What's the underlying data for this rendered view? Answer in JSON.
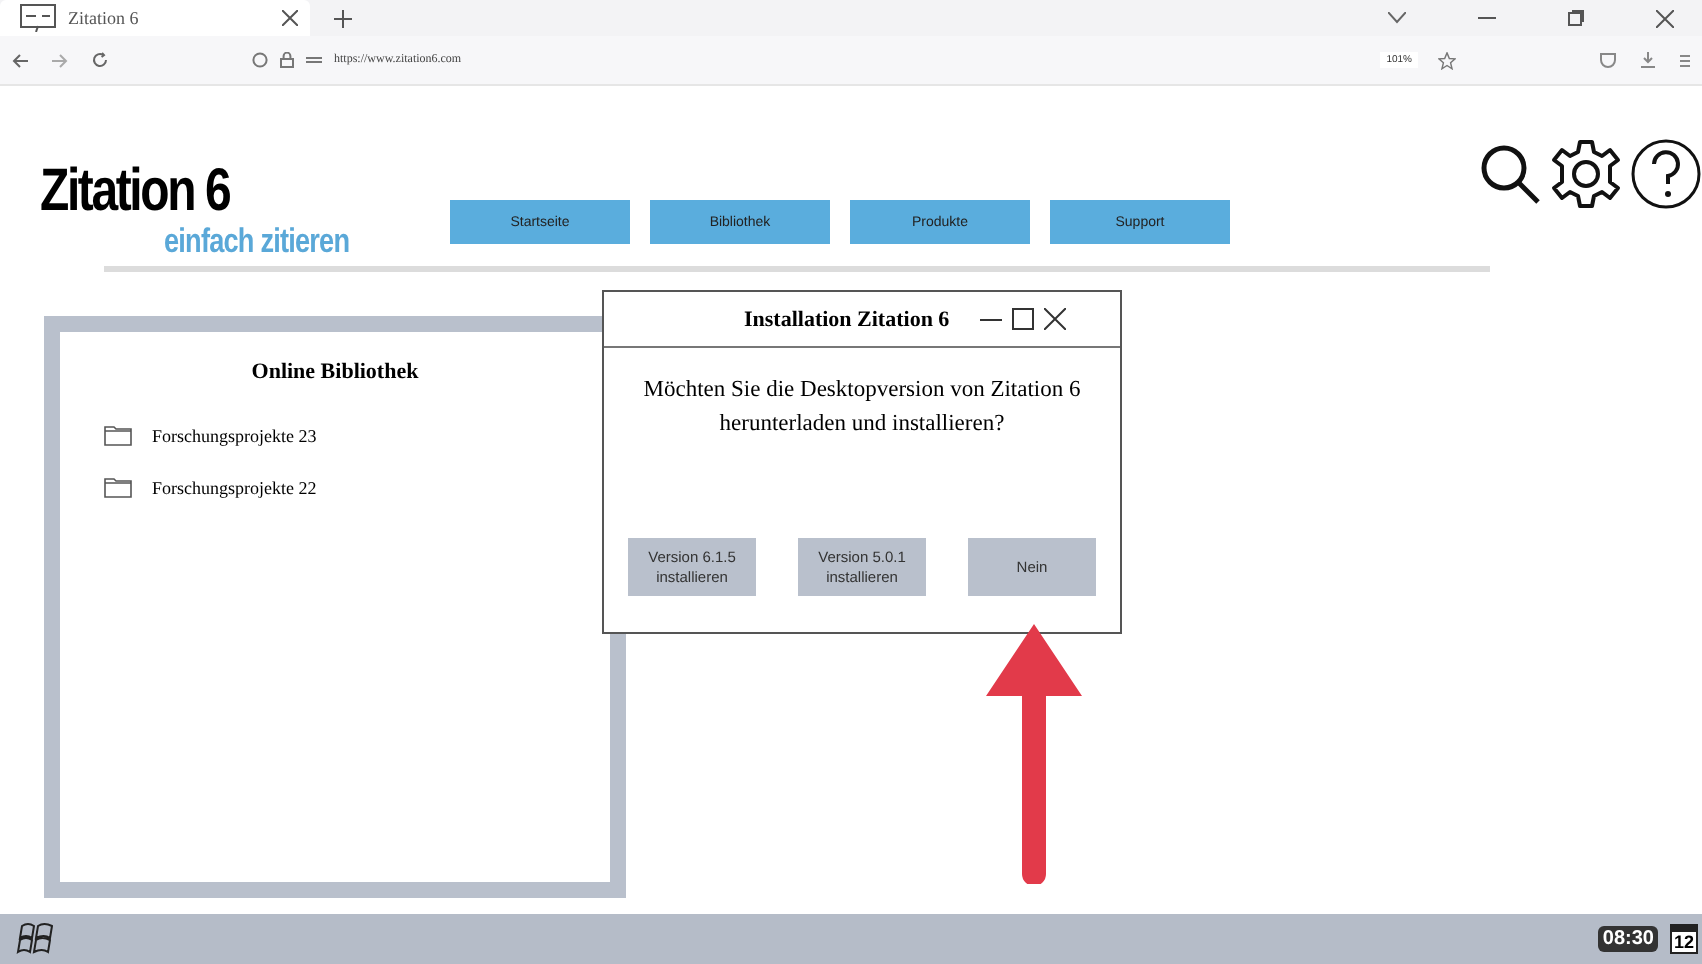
{
  "browser": {
    "tab_title": "Zitation 6",
    "url": "https://www.zitation6.com",
    "zoom": "101%"
  },
  "header": {
    "logo": "Zitation 6",
    "tagline": "einfach zitieren",
    "nav": [
      {
        "label": "Startseite"
      },
      {
        "label": "Bibliothek"
      },
      {
        "label": "Produkte"
      },
      {
        "label": "Support"
      }
    ]
  },
  "library": {
    "title": "Online Bibliothek",
    "folders": [
      {
        "label": "Forschungsprojekte 23"
      },
      {
        "label": "Forschungsprojekte 22"
      }
    ]
  },
  "dialog": {
    "title": "Installation Zitation 6",
    "message": "Möchten Sie die Desktopversion von Zitation 6 herunterladen und installieren?",
    "buttons": [
      {
        "label": "Version 6.1.5 installieren"
      },
      {
        "label": "Version 5.0.1 installieren"
      },
      {
        "label": "Nein"
      }
    ]
  },
  "taskbar": {
    "clock": "08:30",
    "calendar_day": "12"
  }
}
